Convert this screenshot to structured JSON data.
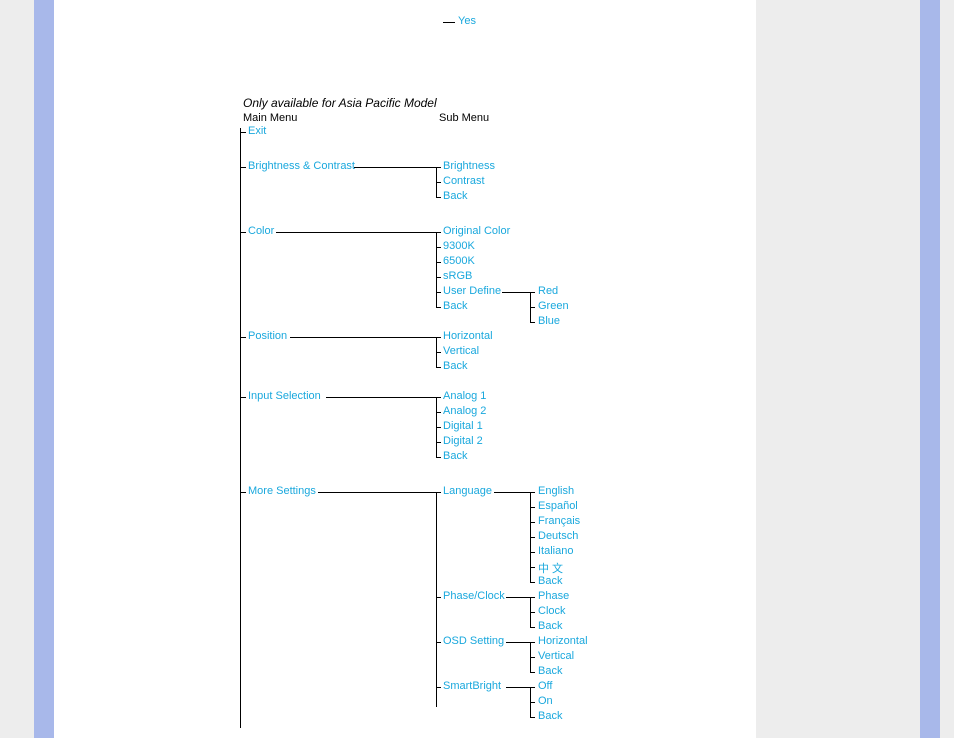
{
  "top_fragment": {
    "yes": "Yes"
  },
  "title": "Only available for Asia Pacific Model",
  "headers": {
    "main": "Main Menu",
    "sub": "Sub Menu"
  },
  "main_items": {
    "exit": "Exit",
    "brightness_contrast": "Brightness & Contrast",
    "color": "Color",
    "position": "Position",
    "input_selection": "Input Selection",
    "more_settings": "More Settings"
  },
  "sub": {
    "brightness_contrast": [
      "Brightness",
      "Contrast",
      "Back"
    ],
    "color": [
      "Original Color",
      "9300K",
      "6500K",
      "sRGB",
      "User Define",
      "Back"
    ],
    "user_define": [
      "Red",
      "Green",
      "Blue"
    ],
    "position": [
      "Horizontal",
      "Vertical",
      "Back"
    ],
    "input_selection": [
      "Analog 1",
      "Analog 2",
      "Digital 1",
      "Digital 2",
      "Back"
    ],
    "more_settings": [
      "Language",
      "Phase/Clock",
      "OSD Setting",
      "SmartBright"
    ],
    "language": [
      "English",
      "Español",
      "Français",
      "Deutsch",
      "Italiano",
      "中 文",
      "Back"
    ],
    "phase_clock": [
      "Phase",
      "Clock",
      "Back"
    ],
    "osd_setting": [
      "Horizontal",
      "Vertical",
      "Back"
    ],
    "smartbright": [
      "Off",
      "On",
      "Back"
    ]
  }
}
